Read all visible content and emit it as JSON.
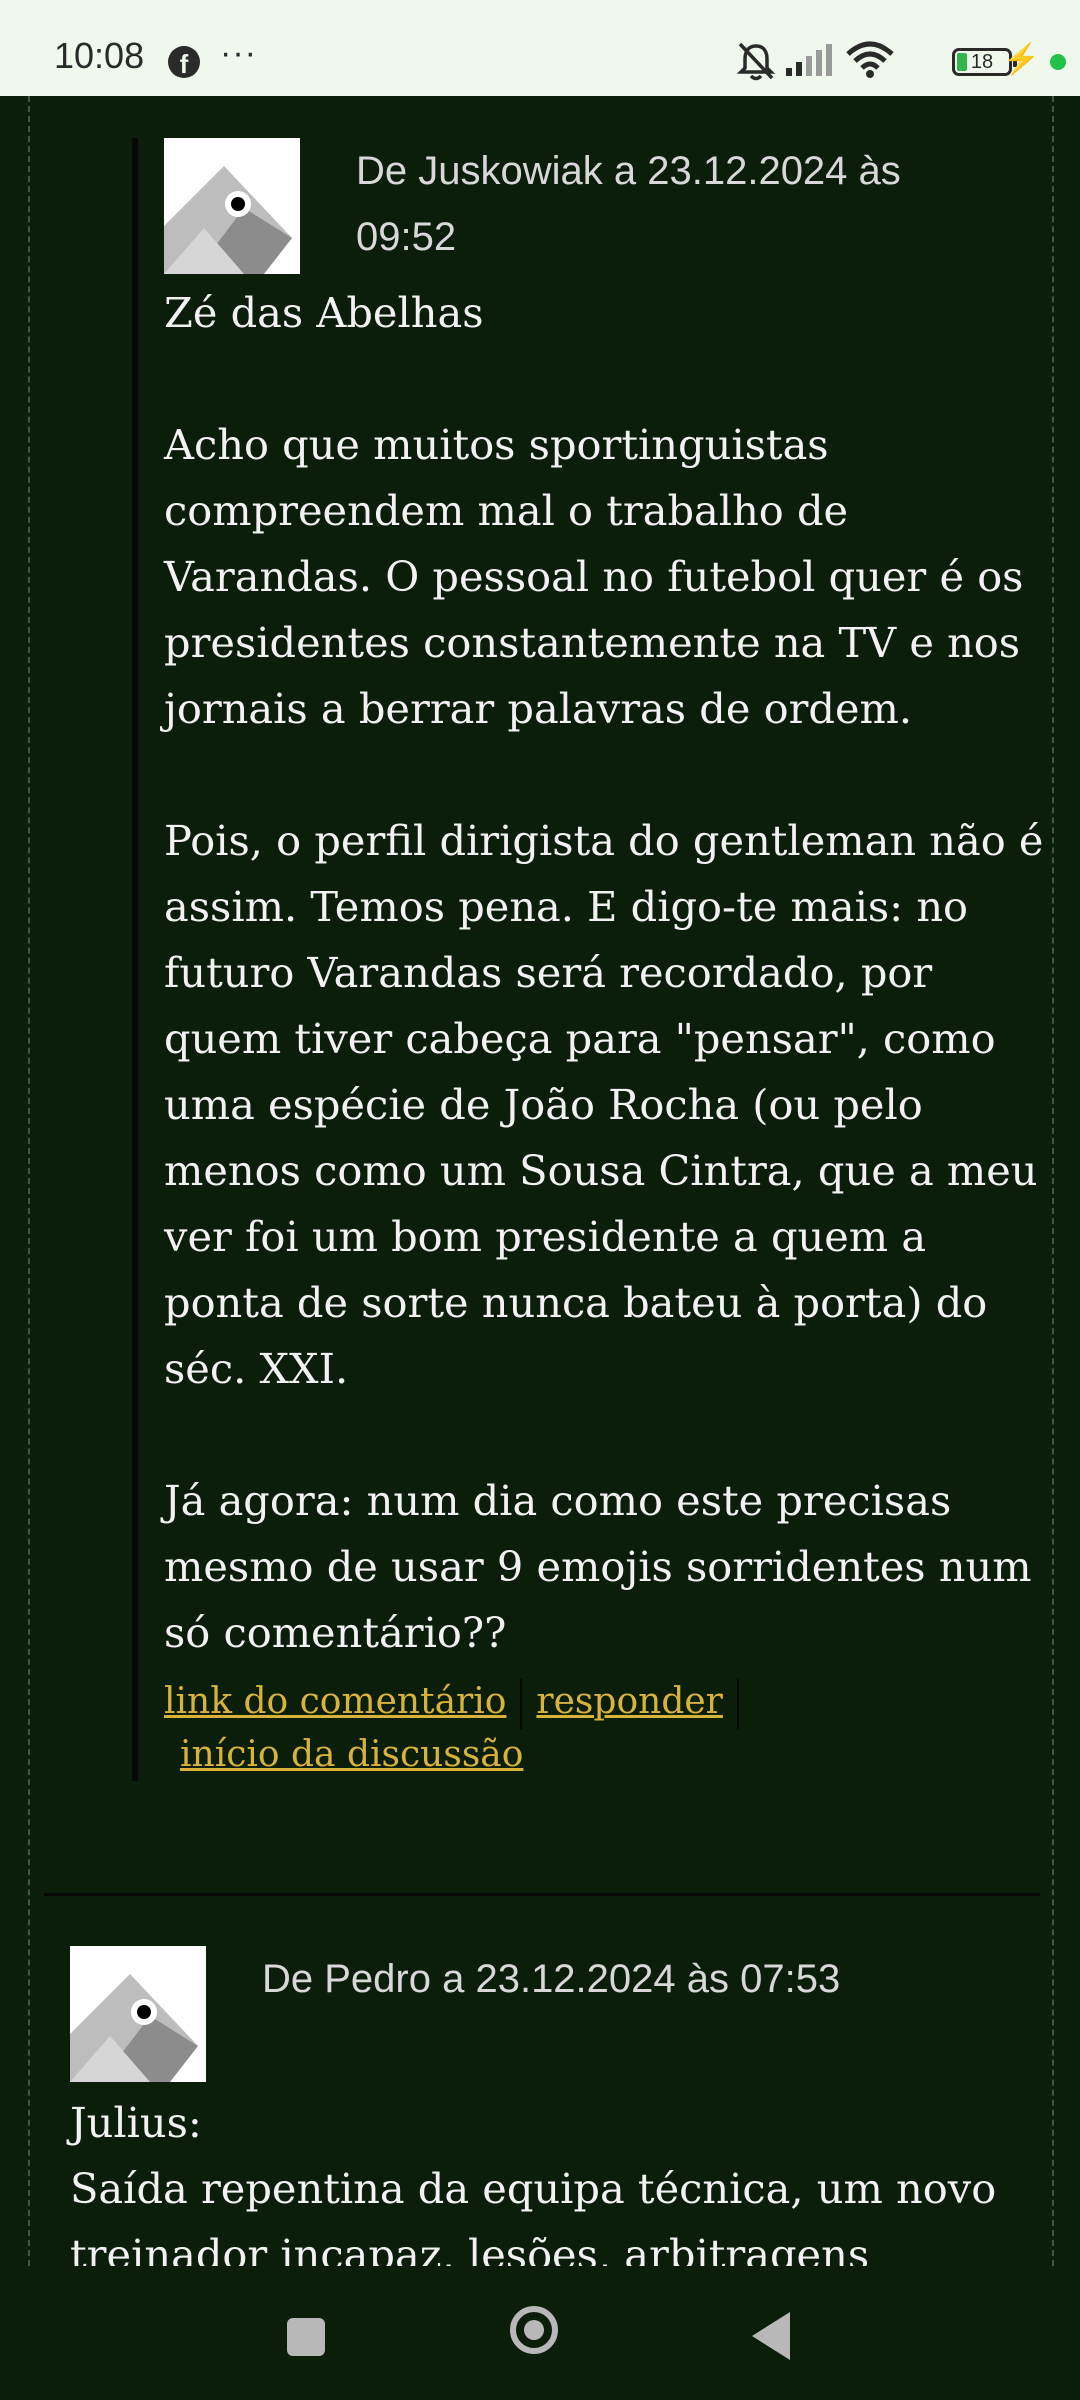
{
  "status_bar": {
    "time": "10:08",
    "notification_icon": "facebook-icon",
    "more": "···",
    "battery_level": "18",
    "icons": [
      "bell-muted-icon",
      "signal-icon",
      "wifi-icon",
      "battery-icon",
      "charging-icon"
    ]
  },
  "comments": [
    {
      "meta": "De Juskowiak a 23.12.2024 às 09:52",
      "body": "Zé das Abelhas\n\nAcho que muitos sportinguistas compreendem mal o trabalho de Varandas. O pessoal no futebol quer é os presidentes constantemente na TV e nos jornais a berrar palavras de ordem.\n\nPois, o perfil dirigista do gentleman não é assim. Temos pena. E digo-te mais: no futuro Varandas será recordado, por quem tiver cabeça para \"pensar\", como uma espécie de João Rocha (ou pelo menos como um Sousa Cintra, que a meu ver foi um bom presidente a quem a ponta de sorte nunca bateu à porta) do séc. XXI.\n\nJá agora: num dia como este precisas mesmo de usar 9 emojis sorridentes num só comentário??",
      "links": {
        "permalink": "link do comentário",
        "reply": "responder",
        "thread_start": "início da discussão"
      }
    },
    {
      "meta": "De Pedro a 23.12.2024 às 07:53",
      "body": "Julius:\nSaída repentina da equipa técnica, um novo treinador incapaz, lesões, arbitragens"
    }
  ],
  "colors": {
    "page_background": "#0a1e0a",
    "link": "#d9b23a",
    "text": "#f2f2f2",
    "meta_text": "#d8d8d8"
  }
}
